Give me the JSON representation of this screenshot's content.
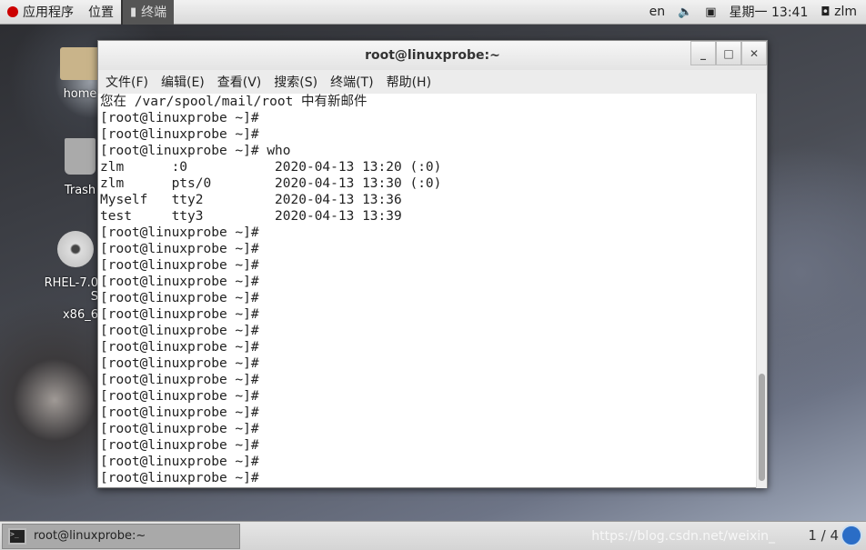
{
  "topbar": {
    "apps": "应用程序",
    "places": "位置",
    "terminal_task": "终端",
    "lang": "en",
    "datetime": "星期一 13:41",
    "user": "zlm"
  },
  "desktop": {
    "icons": [
      {
        "label": "home"
      },
      {
        "label": "Trash"
      },
      {
        "label": "RHEL-7.0 S",
        "label2": "x86_6"
      }
    ]
  },
  "window": {
    "title": "root@linuxprobe:~",
    "menu": [
      "文件(F)",
      "编辑(E)",
      "查看(V)",
      "搜索(S)",
      "终端(T)",
      "帮助(H)"
    ],
    "lines": [
      "您在 /var/spool/mail/root 中有新邮件",
      "[root@linuxprobe ~]#",
      "[root@linuxprobe ~]#",
      "[root@linuxprobe ~]# who",
      "zlm      :0           2020-04-13 13:20 (:0)",
      "zlm      pts/0        2020-04-13 13:30 (:0)",
      "Myself   tty2         2020-04-13 13:36",
      "test     tty3         2020-04-13 13:39",
      "[root@linuxprobe ~]#",
      "[root@linuxprobe ~]#",
      "[root@linuxprobe ~]#",
      "[root@linuxprobe ~]#",
      "[root@linuxprobe ~]#",
      "[root@linuxprobe ~]#",
      "[root@linuxprobe ~]#",
      "[root@linuxprobe ~]#",
      "[root@linuxprobe ~]#",
      "[root@linuxprobe ~]#",
      "[root@linuxprobe ~]#",
      "[root@linuxprobe ~]#",
      "[root@linuxprobe ~]#",
      "[root@linuxprobe ~]#",
      "[root@linuxprobe ~]#",
      "[root@linuxprobe ~]#"
    ]
  },
  "bottombar": {
    "task": "root@linuxprobe:~",
    "workspace": "1 / 4",
    "watermark": "https://blog.csdn.net/weixin_"
  }
}
